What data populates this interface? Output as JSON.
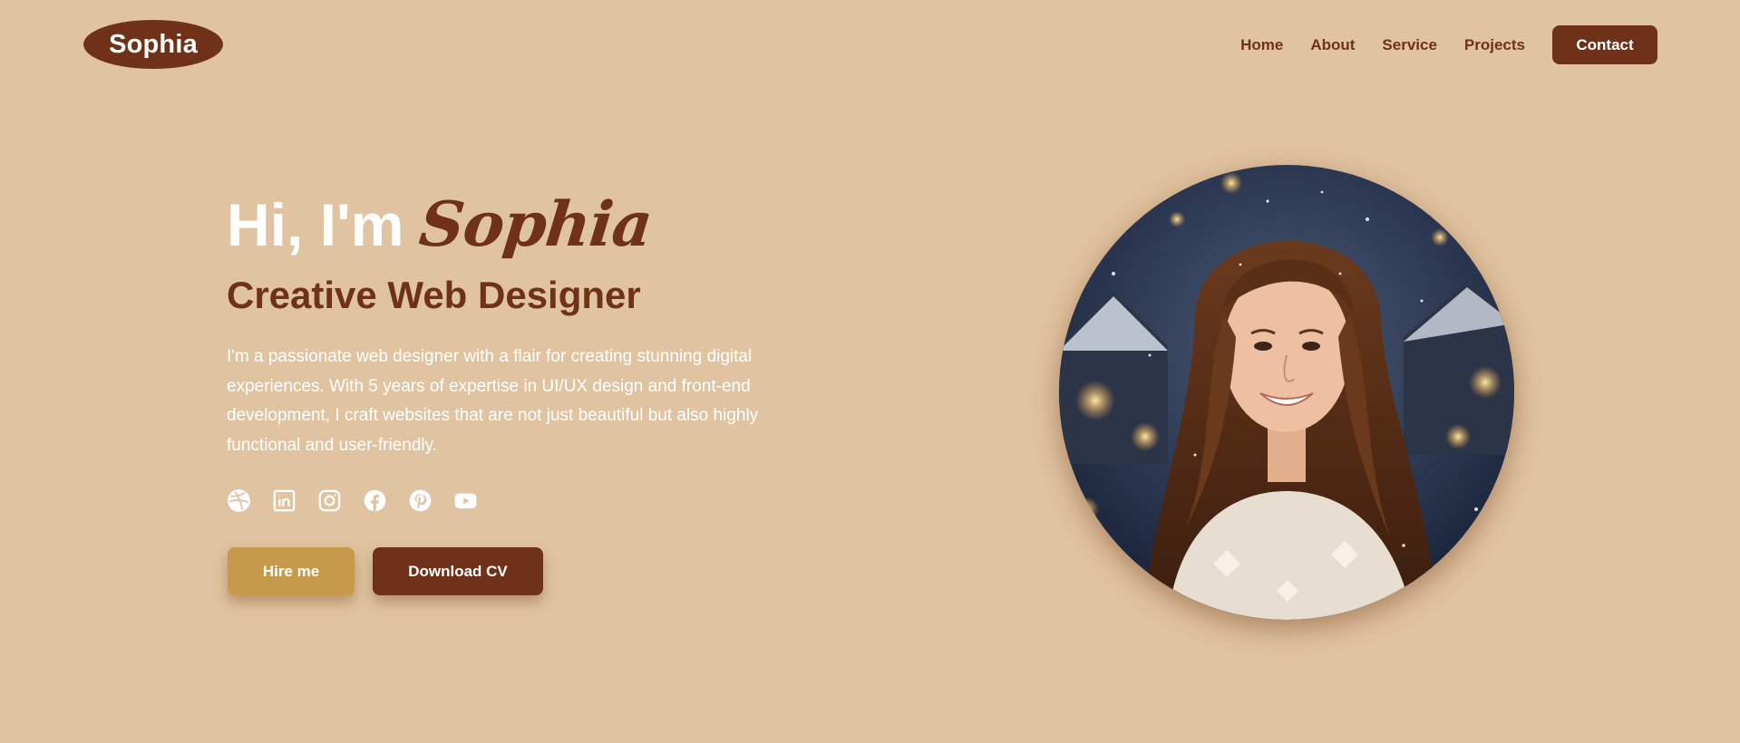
{
  "header": {
    "logo": "Sophia",
    "nav": [
      "Home",
      "About",
      "Service",
      "Projects"
    ],
    "contact_label": "Contact"
  },
  "hero": {
    "greeting_prefix": "Hi, I'm",
    "greeting_name": "Sophia",
    "role": "Creative Web Designer",
    "bio": "I'm a passionate web designer with a flair for creating stunning digital experiences. With 5 years of expertise in UI/UX design and front-end development, I craft websites that are not just beautiful but also highly functional and user-friendly.",
    "socials": [
      "dribbble-icon",
      "linkedin-icon",
      "instagram-icon",
      "facebook-icon",
      "pinterest-icon",
      "youtube-icon"
    ],
    "hire_label": "Hire me",
    "cv_label": "Download CV"
  },
  "colors": {
    "background": "#e0c3a0",
    "primary": "#6f3218",
    "accent": "#c69a4a",
    "text_light": "#ffffff"
  }
}
